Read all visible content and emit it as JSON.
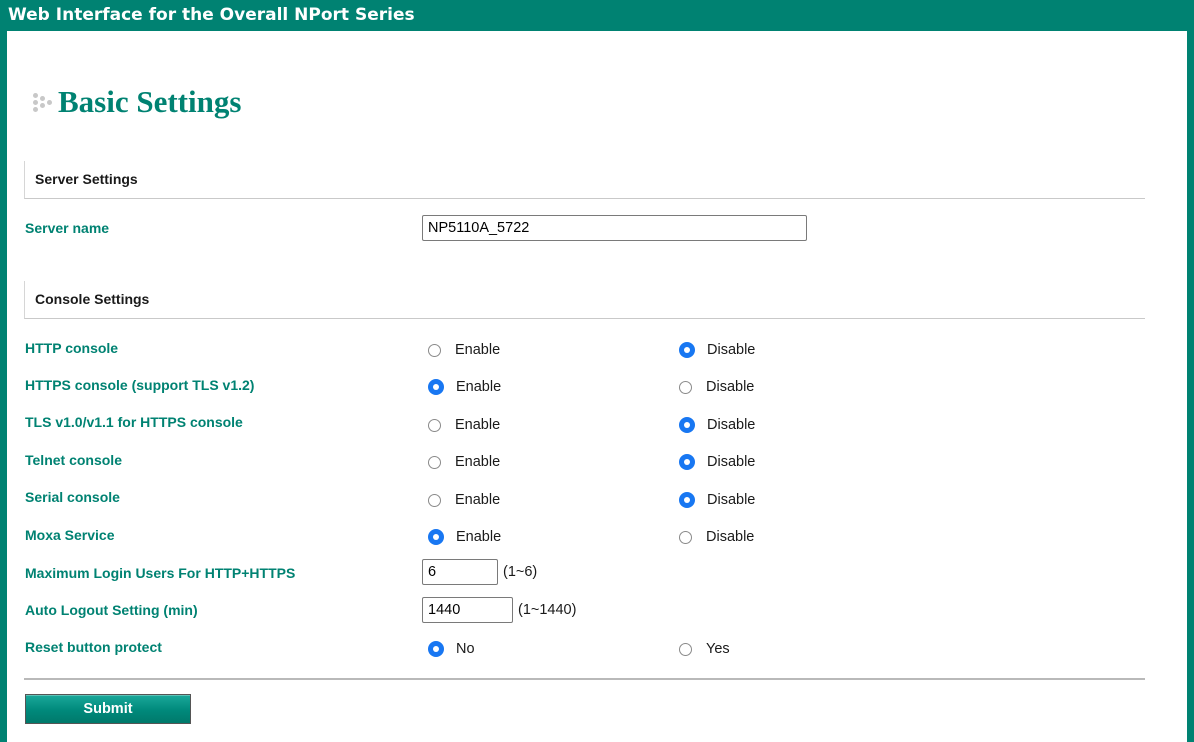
{
  "banner": {
    "title": "Web Interface for the Overall NPort Series"
  },
  "page": {
    "title": "Basic Settings"
  },
  "server_settings": {
    "header": "Server Settings",
    "server_name_label": "Server name",
    "server_name_value": "NP5110A_5722"
  },
  "console_settings": {
    "header": "Console Settings",
    "http": {
      "label": "HTTP console",
      "enable": "Enable",
      "disable": "Disable",
      "selected": "Disable"
    },
    "https": {
      "label": "HTTPS console (support TLS v1.2)",
      "enable": "Enable",
      "disable": "Disable",
      "selected": "Enable"
    },
    "tls": {
      "label": "TLS v1.0/v1.1 for HTTPS console",
      "enable": "Enable",
      "disable": "Disable",
      "selected": "Disable"
    },
    "telnet": {
      "label": "Telnet console",
      "enable": "Enable",
      "disable": "Disable",
      "selected": "Disable"
    },
    "serial": {
      "label": "Serial console",
      "enable": "Enable",
      "disable": "Disable",
      "selected": "Disable"
    },
    "moxa": {
      "label": "Moxa Service",
      "enable": "Enable",
      "disable": "Disable",
      "selected": "Enable"
    },
    "max_login": {
      "label": "Maximum Login Users For HTTP+HTTPS",
      "value": "6",
      "range": "(1~6)"
    },
    "auto_logout": {
      "label": "Auto Logout Setting (min)",
      "value": "1440",
      "range": "(1~1440)"
    },
    "reset_protect": {
      "label": "Reset button protect",
      "no": "No",
      "yes": "Yes",
      "selected": "No"
    }
  },
  "actions": {
    "submit_label": "Submit"
  },
  "colors": {
    "brand": "#008272",
    "radio_selected": "#1877f2"
  },
  "icons": {
    "title_bullet": "dots-icon"
  }
}
